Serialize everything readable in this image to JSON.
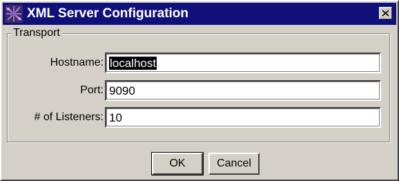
{
  "window": {
    "title": "XML Server Configuration",
    "icon": "xml-network-icon",
    "close_icon": "close-icon"
  },
  "transport": {
    "group_label": "Transport",
    "fields": [
      {
        "label": "Hostname:",
        "value": "localhost",
        "selected_text": "localhost"
      },
      {
        "label": "Port:",
        "value": "9090"
      },
      {
        "label": "# of Listeners:",
        "value": "10"
      }
    ]
  },
  "buttons": {
    "ok_label": "OK",
    "cancel_label": "Cancel"
  },
  "colors": {
    "titlebar": "#10107a",
    "face": "#d4d0c8"
  }
}
